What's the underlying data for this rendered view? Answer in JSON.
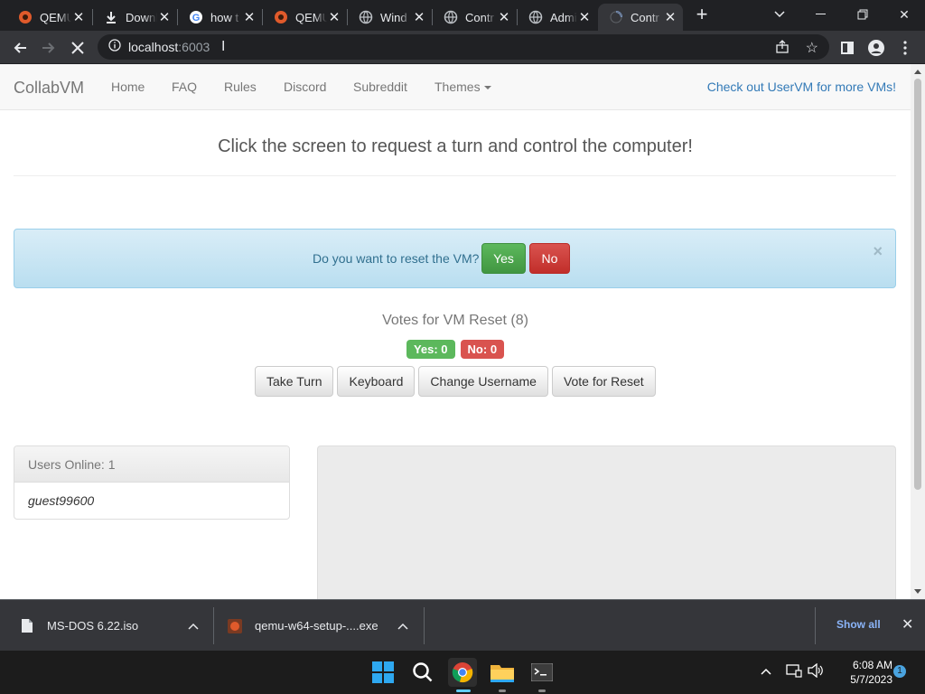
{
  "browser": {
    "tabs": [
      {
        "title": "QEMU",
        "favicon": "qemu-icon"
      },
      {
        "title": "Downloads",
        "favicon": "download-icon"
      },
      {
        "title": "how t",
        "favicon": "google-icon"
      },
      {
        "title": "QEMU",
        "favicon": "qemu-icon"
      },
      {
        "title": "Wind",
        "favicon": "globe-icon"
      },
      {
        "title": "Contr",
        "favicon": "globe-icon"
      },
      {
        "title": "Admi",
        "favicon": "globe-icon"
      },
      {
        "title": "Contr",
        "favicon": "loading-icon"
      }
    ],
    "address": {
      "host": "localhost",
      "port": ":6003"
    }
  },
  "page": {
    "brand": "CollabVM",
    "nav": [
      "Home",
      "FAQ",
      "Rules",
      "Discord",
      "Subreddit",
      "Themes"
    ],
    "nav_right": "Check out UserVM for more VMs!",
    "headline": "Click the screen to request a turn and control the computer!",
    "reset_prompt": {
      "question": "Do you want to reset the VM?",
      "yes": "Yes",
      "no": "No",
      "close": "×"
    },
    "votes_title": "Votes for VM Reset (8)",
    "badges": {
      "yes": "Yes: 0",
      "no": "No: 0"
    },
    "actions": [
      "Take Turn",
      "Keyboard",
      "Change Username",
      "Vote for Reset"
    ],
    "users_online": "Users Online: 1",
    "users": [
      "guest99600"
    ]
  },
  "downloads": {
    "items": [
      "MS-DOS 6.22.iso",
      "qemu-w64-setup-....exe"
    ],
    "show_all": "Show all"
  },
  "taskbar": {
    "time": "6:08 AM",
    "date": "5/7/2023",
    "notifications": "1"
  },
  "colors": {
    "success": "#5cb85c",
    "danger": "#d9534f",
    "link": "#337ab7",
    "alert_bg": "#d9edf7"
  }
}
